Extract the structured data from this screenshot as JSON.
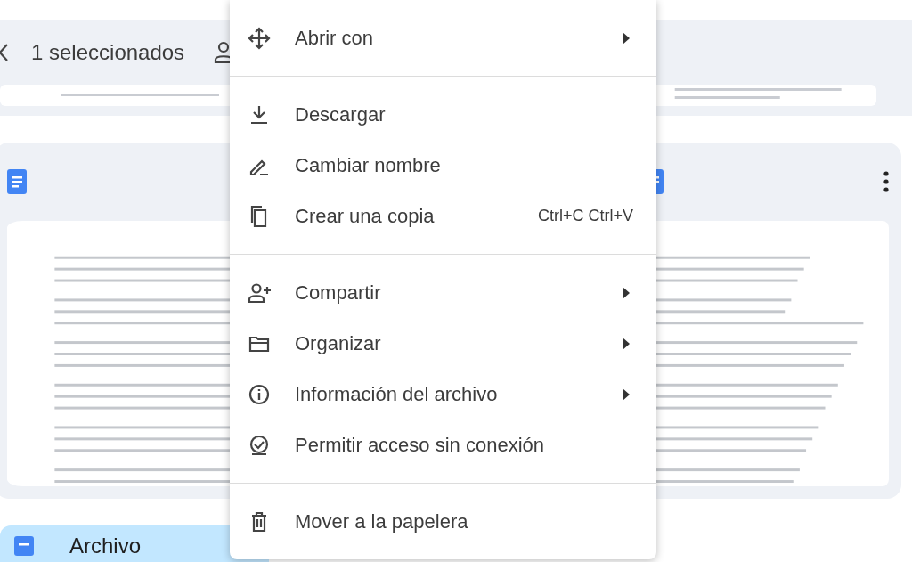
{
  "toolbar": {
    "selection_count": "1 seleccionados"
  },
  "cards": [
    {
      "kind": "doc"
    },
    {
      "kind": "doc",
      "has_menu": true
    }
  ],
  "bottom_files": [
    {
      "name": "Archivo",
      "selected": true
    }
  ],
  "context_menu": {
    "sections": [
      [
        {
          "label": "Abrir con",
          "submenu": true
        }
      ],
      [
        {
          "label": "Descargar",
          "submenu": false
        },
        {
          "label": "Cambiar nombre",
          "submenu": false
        },
        {
          "label": "Crear una copia",
          "submenu": false,
          "shortcut": "Ctrl+C Ctrl+V"
        }
      ],
      [
        {
          "label": "Compartir",
          "submenu": true
        },
        {
          "label": "Organizar",
          "submenu": true
        },
        {
          "label": "Información del archivo",
          "submenu": true
        },
        {
          "label": "Permitir acceso sin conexión",
          "submenu": false
        }
      ],
      [
        {
          "label": "Mover a la papelera",
          "submenu": false
        }
      ]
    ]
  }
}
